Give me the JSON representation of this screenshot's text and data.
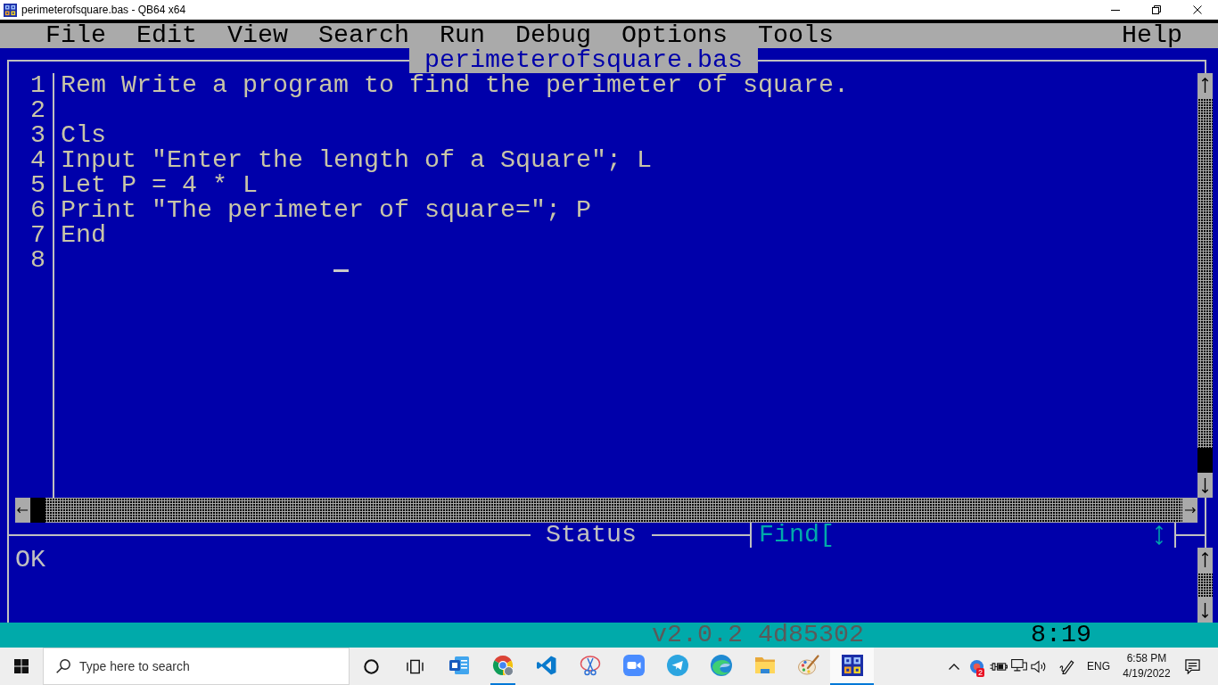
{
  "window": {
    "title": "perimeterofsquare.bas - QB64 x64"
  },
  "menu": {
    "left": [
      "File",
      "Edit",
      "View",
      "Search",
      "Run",
      "Debug",
      "Options",
      "Tools"
    ],
    "right": [
      "Help"
    ]
  },
  "editor": {
    "file_tab": "perimeterofsquare.bas",
    "lines": [
      {
        "number": "1",
        "text": "Rem Write a program to find the perimeter of square."
      },
      {
        "number": "2"
      },
      {
        "number": "3",
        "text": "Cls"
      },
      {
        "number": "4",
        "text": "Input \"Enter the length of a Square\"; L"
      },
      {
        "number": "5",
        "text": "Let P = 4 * L"
      },
      {
        "number": "6",
        "text": "Print \"The perimeter of square=\"; P"
      },
      {
        "number": "7",
        "text": "End"
      },
      {
        "number": "8"
      }
    ]
  },
  "status_panel": {
    "title": "Status",
    "find_label": "Find[",
    "message": "OK"
  },
  "status_bar": {
    "version": "v2.0.2 4d85302",
    "position": "8:19"
  },
  "taskbar": {
    "search": {
      "placeholder": "Type here to search"
    },
    "apps": [
      {
        "kind": "doc",
        "running": false,
        "selected": false
      },
      {
        "kind": "globe",
        "running": true,
        "selected": false
      },
      {
        "kind": "code",
        "running": false,
        "selected": false
      },
      {
        "kind": "scissors",
        "running": false,
        "selected": false
      },
      {
        "kind": "camera",
        "running": false,
        "selected": false
      },
      {
        "kind": "plane",
        "running": false,
        "selected": false
      },
      {
        "kind": "wave",
        "running": false,
        "selected": false
      },
      {
        "kind": "folder",
        "running": false,
        "selected": false
      },
      {
        "kind": "palette",
        "running": false,
        "selected": false
      },
      {
        "kind": "qb",
        "running": true,
        "selected": true
      }
    ],
    "tray": {
      "badge": "2",
      "language": "ENG",
      "time": "6:58 PM",
      "date": "4/19/2022"
    }
  }
}
